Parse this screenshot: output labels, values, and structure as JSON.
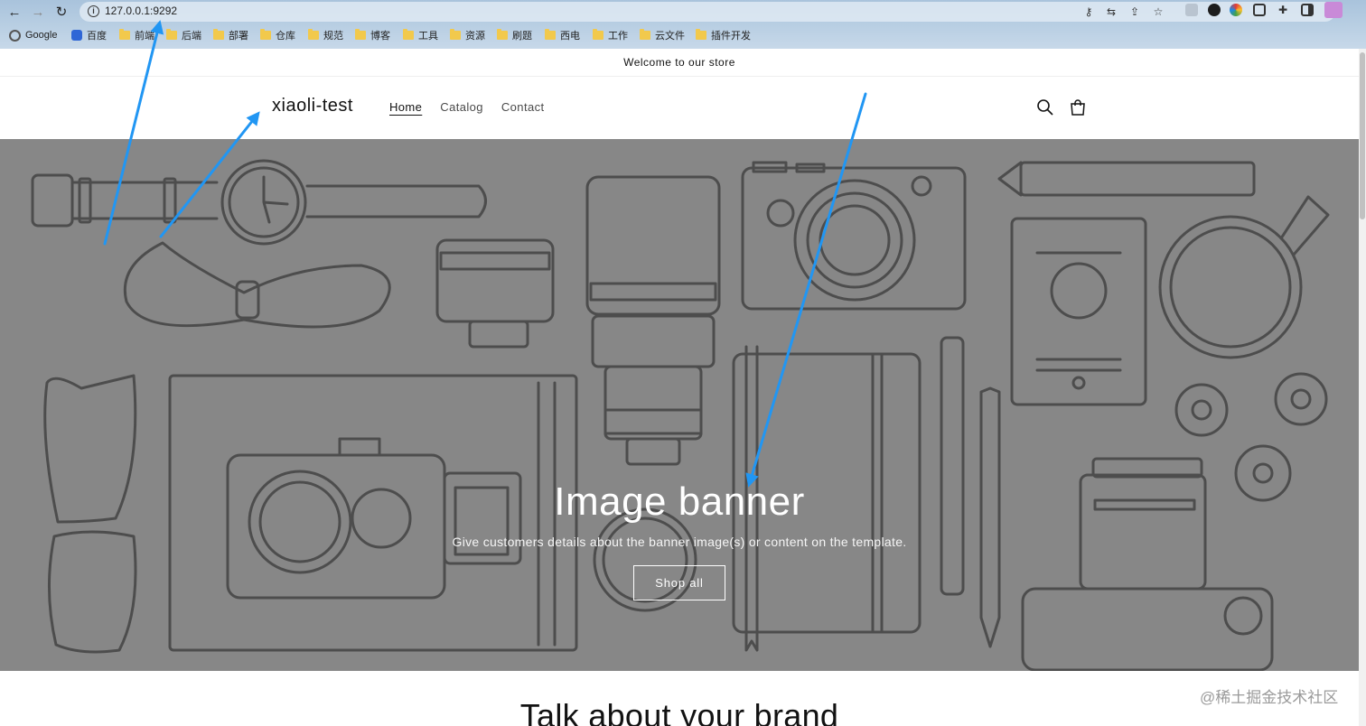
{
  "browser": {
    "url": "127.0.0.1:9292",
    "bookmarks": [
      "Google",
      "百度",
      "前端",
      "后端",
      "部署",
      "仓库",
      "规范",
      "博客",
      "工具",
      "资源",
      "刷题",
      "西电",
      "工作",
      "云文件",
      "插件开发"
    ]
  },
  "store": {
    "announcement": "Welcome to our store",
    "logo": "xiaoli-test",
    "nav": [
      "Home",
      "Catalog",
      "Contact"
    ],
    "banner": {
      "title": "Image banner",
      "subtitle": "Give customers details about the banner image(s) or content on the template.",
      "button": "Shop all"
    },
    "brand_heading": "Talk about your brand"
  },
  "watermark": "@稀土掘金技术社区",
  "colors": {
    "banner_bg": "#878787",
    "illustration_stroke": "#4d4d4d",
    "annotation_arrow": "#2196f3"
  }
}
